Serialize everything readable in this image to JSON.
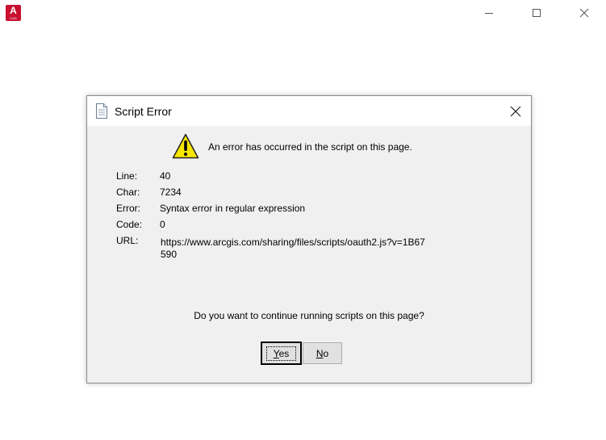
{
  "app": {
    "icon_letter": "A",
    "icon_sublabel": "CAD",
    "brand_color": "#c8102e"
  },
  "window_controls": {
    "minimize_icon": "minimize-icon",
    "maximize_icon": "maximize-icon",
    "close_icon": "close-icon"
  },
  "dialog": {
    "title": "Script Error",
    "message": "An error has occurred in the script on this page.",
    "details": {
      "line_label": "Line:",
      "line_value": "40",
      "char_label": "Char:",
      "char_value": "7234",
      "error_label": "Error:",
      "error_value": "Syntax error in regular expression",
      "code_label": "Code:",
      "code_value": "0",
      "url_label": "URL:",
      "url_value": "https://www.arcgis.com/sharing/files/scripts/oauth2.js?v=1B67590"
    },
    "question": "Do you want to continue running scripts on this page?",
    "yes_label": "Yes",
    "no_label": "No"
  }
}
